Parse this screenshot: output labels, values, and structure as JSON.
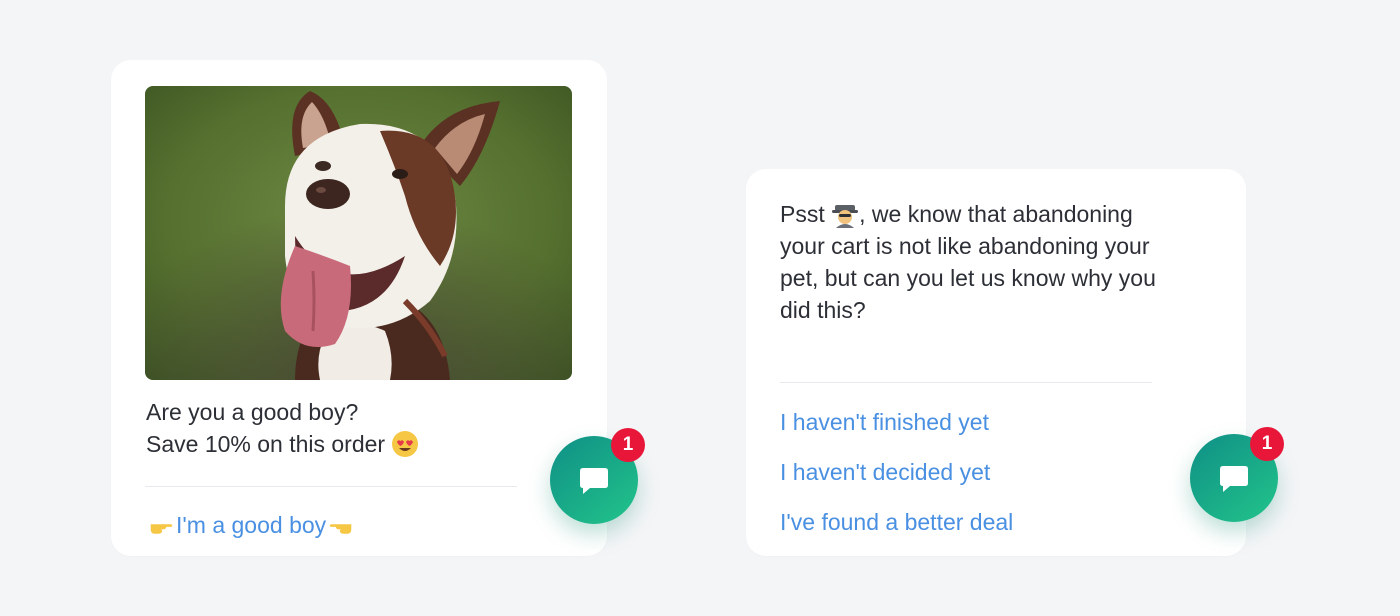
{
  "left_card": {
    "image_alt": "Smiling brown and white dog with tongue out",
    "message_line1": "Are you a good boy?",
    "message_line2": "Save 10% on this order",
    "message_emoji": "heart-eyes-emoji",
    "reply_label": "I'm a good boy",
    "reply_emoji_left": "pointing-right-emoji",
    "reply_emoji_right": "pointing-left-emoji"
  },
  "right_card": {
    "message_prefix": "Psst",
    "message_emoji": "detective-emoji",
    "message_rest": ", we know that abandoning your cart is not like abandoning your pet, but can you let us know why you did this?",
    "replies": [
      "I haven't finished yet",
      "I haven't decided yet",
      "I've found a better deal"
    ]
  },
  "launchers": [
    {
      "icon": "chat-bubble-icon",
      "badge": "1"
    },
    {
      "icon": "chat-bubble-icon",
      "badge": "1"
    }
  ],
  "colors": {
    "background": "#f4f5f7",
    "card": "#ffffff",
    "link": "#4a90e2",
    "launcher_start": "#0f8f86",
    "launcher_end": "#22c48a",
    "badge": "#e8173a"
  }
}
